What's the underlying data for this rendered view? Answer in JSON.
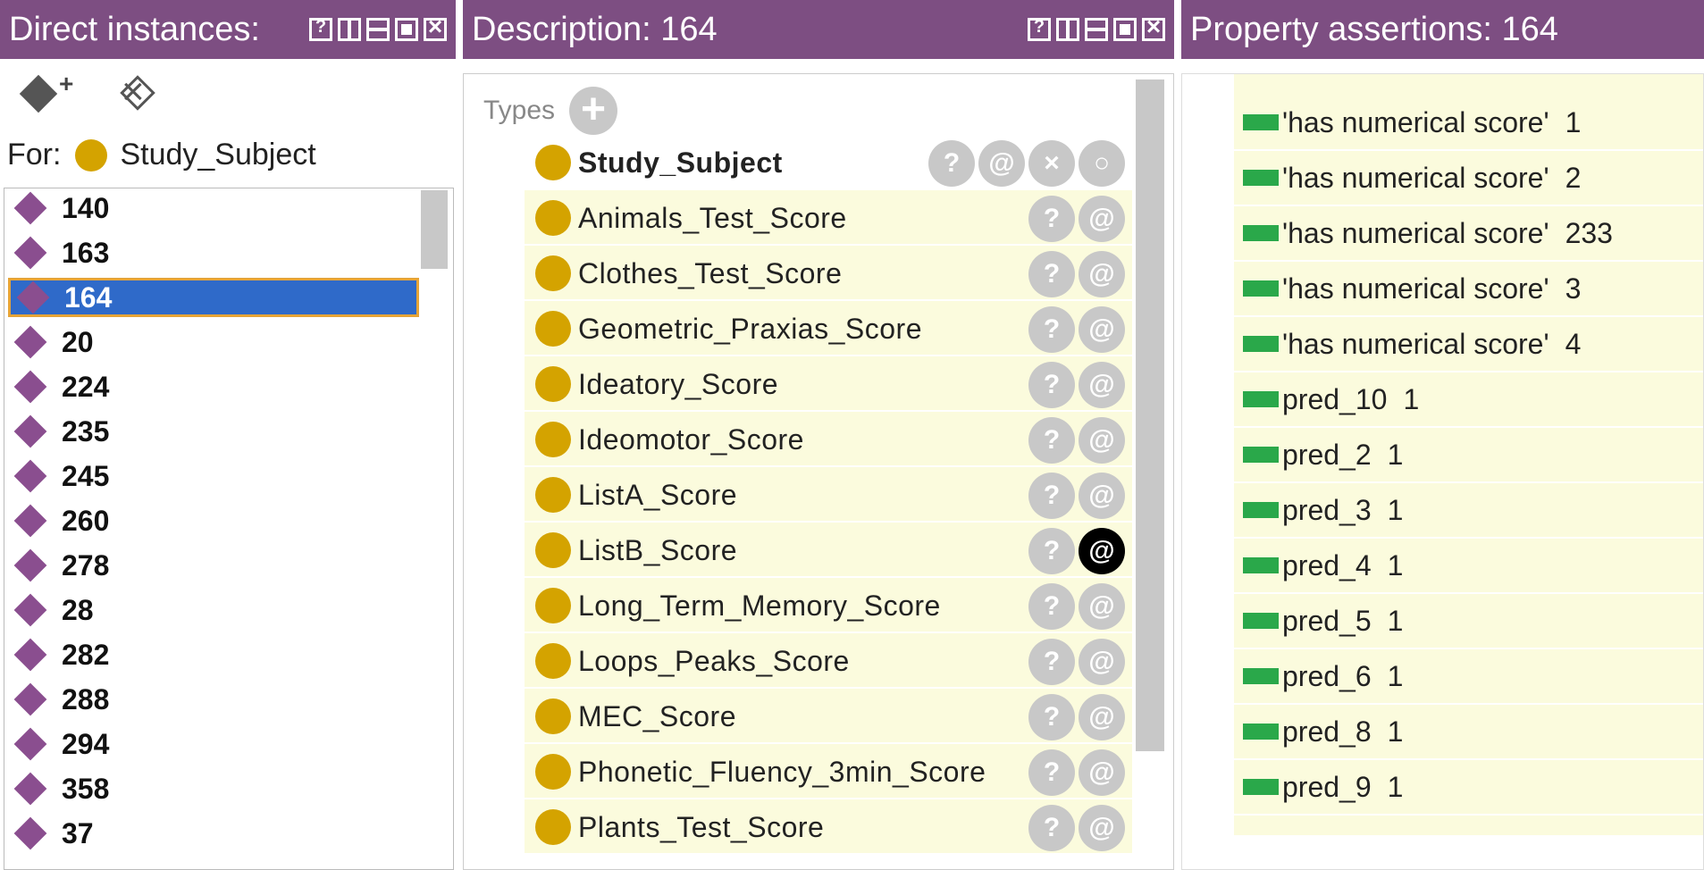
{
  "direct_instances": {
    "title": "Direct instances:",
    "for_label": "For:",
    "for_class": "Study_Subject",
    "items": [
      "140",
      "163",
      "164",
      "20",
      "224",
      "235",
      "245",
      "260",
      "278",
      "28",
      "282",
      "288",
      "294",
      "358",
      "37"
    ],
    "selected": "164"
  },
  "description": {
    "title": "Description: 164",
    "types_label": "Types",
    "types": [
      "Study_Subject",
      "Animals_Test_Score",
      "Clothes_Test_Score",
      "Geometric_Praxias_Score",
      "Ideatory_Score",
      "Ideomotor_Score",
      "ListA_Score",
      "ListB_Score",
      "Long_Term_Memory_Score",
      "Loops_Peaks_Score",
      "MEC_Score",
      "Phonetic_Fluency_3min_Score",
      "Plants_Test_Score"
    ]
  },
  "property_assertions": {
    "title": "Property assertions: 164",
    "rows": [
      {
        "prop": "'has numerical score'",
        "value": "1"
      },
      {
        "prop": "'has numerical score'",
        "value": "2"
      },
      {
        "prop": "'has numerical score'",
        "value": "233"
      },
      {
        "prop": "'has numerical score'",
        "value": "3"
      },
      {
        "prop": "'has numerical score'",
        "value": "4"
      },
      {
        "prop": "pred_10",
        "value": "1"
      },
      {
        "prop": "pred_2",
        "value": "1"
      },
      {
        "prop": "pred_3",
        "value": "1"
      },
      {
        "prop": "pred_4",
        "value": "1"
      },
      {
        "prop": "pred_5",
        "value": "1"
      },
      {
        "prop": "pred_6",
        "value": "1"
      },
      {
        "prop": "pred_8",
        "value": "1"
      },
      {
        "prop": "pred_9",
        "value": "1"
      }
    ]
  },
  "button_glyphs": {
    "help": "?",
    "annotate": "@",
    "delete": "×",
    "explain": "○"
  },
  "colors": {
    "titlebar": "#7d4e82",
    "class_dot": "#d4a300",
    "individual": "#8a4e8f",
    "property": "#2aa84a",
    "selection": "#2f6ac9"
  }
}
